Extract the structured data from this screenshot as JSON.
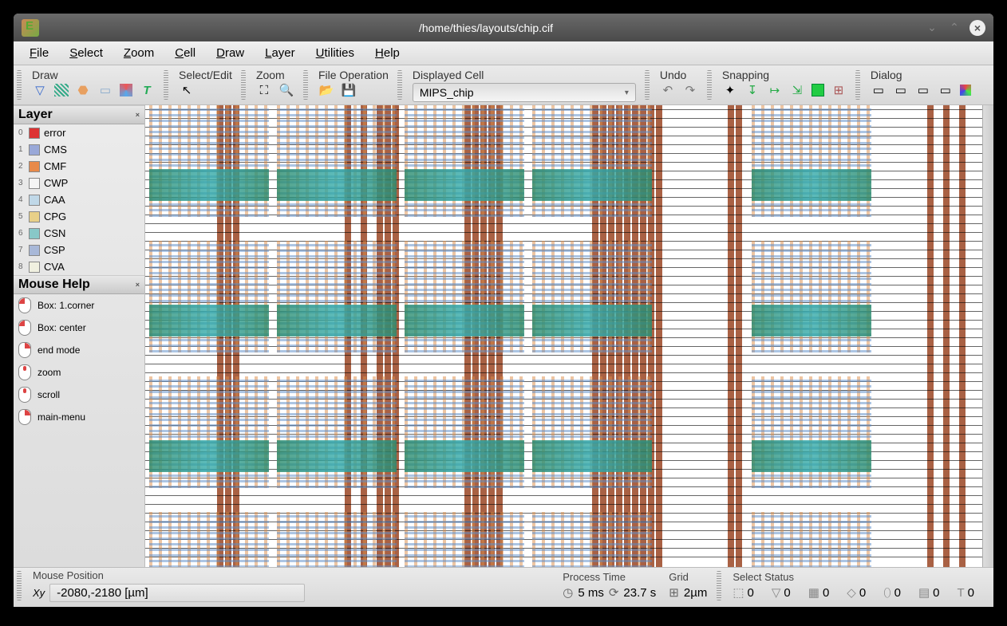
{
  "window": {
    "title": "/home/thies/layouts/chip.cif"
  },
  "menu": [
    "File",
    "Select",
    "Zoom",
    "Cell",
    "Draw",
    "Layer",
    "Utilities",
    "Help"
  ],
  "toolbar": {
    "draw": "Draw",
    "select_edit": "Select/Edit",
    "zoom": "Zoom",
    "file_op": "File Operation",
    "displayed_cell": "Displayed Cell",
    "cell_value": "MIPS_chip",
    "undo": "Undo",
    "snapping": "Snapping",
    "dialog": "Dialog"
  },
  "layer_panel": {
    "title": "Layer",
    "items": [
      {
        "n": "0",
        "name": "error",
        "color": "#d33"
      },
      {
        "n": "1",
        "name": "CMS",
        "color": "#99a8d8"
      },
      {
        "n": "2",
        "name": "CMF",
        "color": "#e88a4a"
      },
      {
        "n": "3",
        "name": "CWP",
        "color": "#f5f5f5"
      },
      {
        "n": "4",
        "name": "CAA",
        "color": "#c0d8e8"
      },
      {
        "n": "5",
        "name": "CPG",
        "color": "#e8d088"
      },
      {
        "n": "6",
        "name": "CSN",
        "color": "#88c8c8"
      },
      {
        "n": "7",
        "name": "CSP",
        "color": "#a8b8d8"
      },
      {
        "n": "8",
        "name": "CVA",
        "color": "#f0f0e0"
      }
    ]
  },
  "mouse_help": {
    "title": "Mouse Help",
    "items": [
      {
        "btn": "lb",
        "label": "Box: 1.corner"
      },
      {
        "btn": "lb",
        "label": "Box: center"
      },
      {
        "btn": "rb",
        "label": "end mode"
      },
      {
        "btn": "mb",
        "label": "zoom"
      },
      {
        "btn": "mb",
        "label": "scroll"
      },
      {
        "btn": "rb",
        "label": "main-menu"
      }
    ]
  },
  "status": {
    "mouse_pos_label": "Mouse Position",
    "mouse_pos_value": "-2080,-2180 [µm]",
    "xy": "Xy",
    "process_time_label": "Process Time",
    "process_time_value": "5 ms",
    "time2": "23.7 s",
    "grid_label": "Grid",
    "grid_value": "2µm",
    "select_status_label": "Select Status",
    "sel": [
      {
        "icon": "⬚",
        "v": "0"
      },
      {
        "icon": "▽",
        "v": "0"
      },
      {
        "icon": "▦",
        "v": "0"
      },
      {
        "icon": "◇",
        "v": "0"
      },
      {
        "icon": "⬯",
        "v": "0"
      },
      {
        "icon": "▤",
        "v": "0"
      },
      {
        "icon": "T",
        "v": "0"
      }
    ]
  }
}
